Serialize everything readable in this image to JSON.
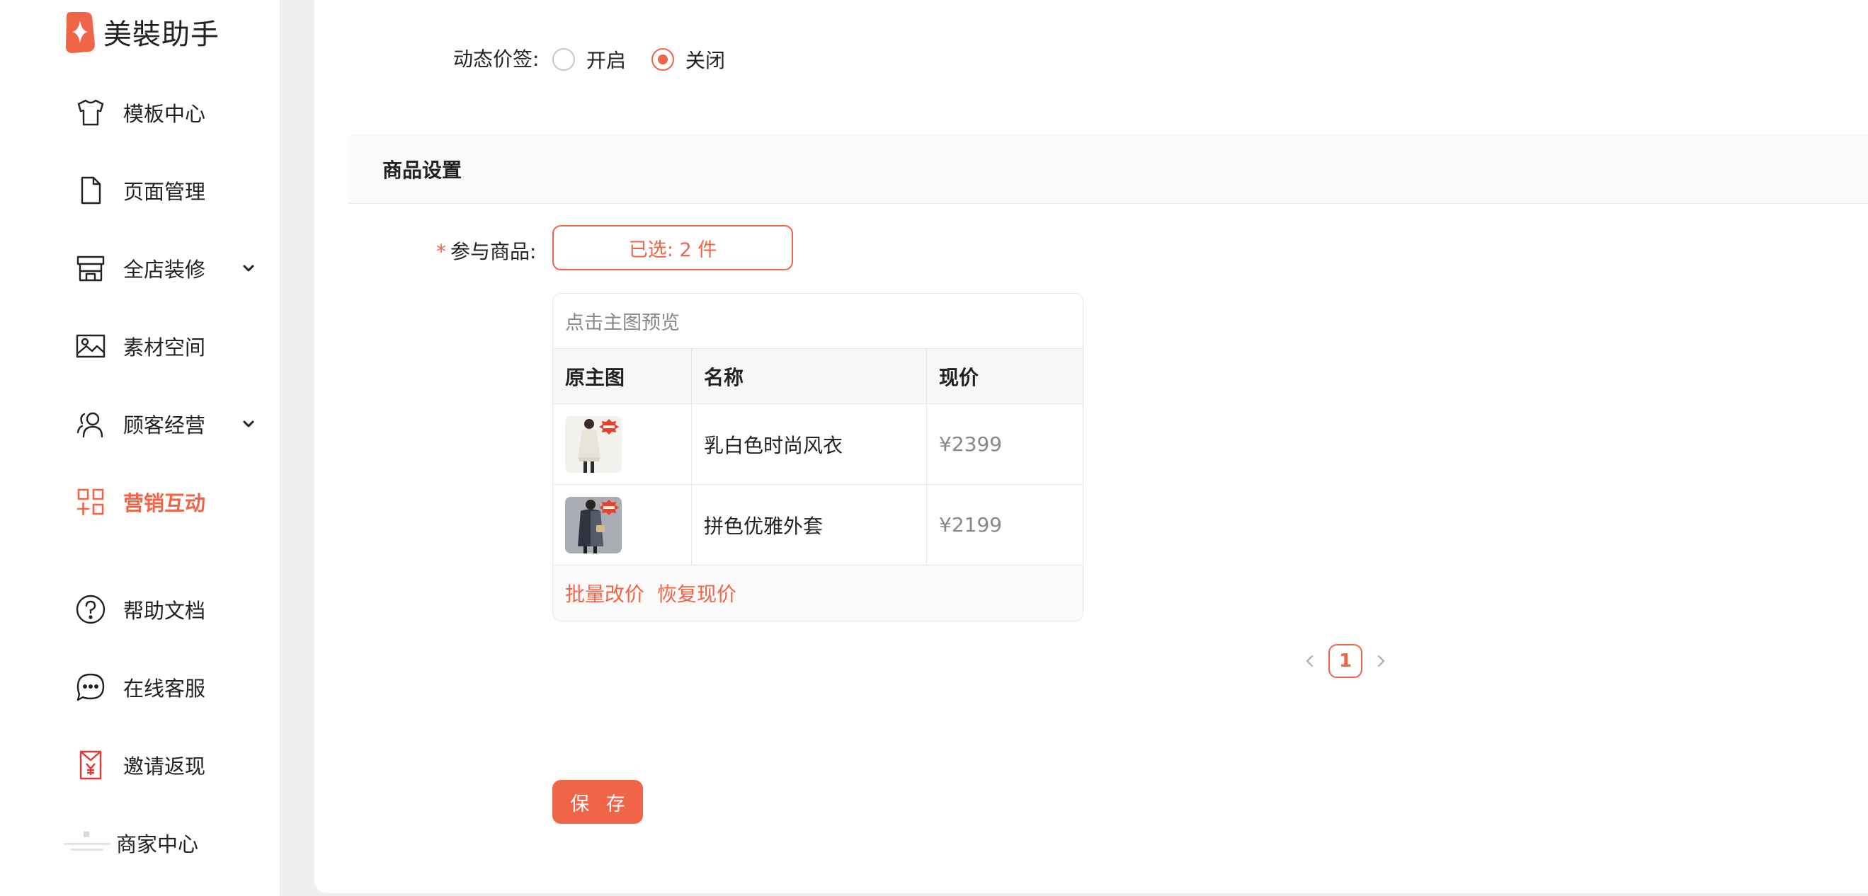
{
  "brand": {
    "name": "美裝助手",
    "accent": "#f06548"
  },
  "sidebar": {
    "items": [
      {
        "label": "模板中心",
        "icon": "tshirt-icon"
      },
      {
        "label": "页面管理",
        "icon": "document-icon"
      },
      {
        "label": "全店装修",
        "icon": "store-icon",
        "has_chevron": true
      },
      {
        "label": "素材空间",
        "icon": "image-icon"
      },
      {
        "label": "顾客经营",
        "icon": "users-icon",
        "has_chevron": true
      },
      {
        "label": "营销互动",
        "icon": "grid-plus-icon",
        "active": true
      },
      {
        "label": "帮助文档",
        "icon": "help-icon"
      },
      {
        "label": "在线客服",
        "icon": "chat-icon"
      },
      {
        "label": "邀请返现",
        "icon": "red-envelope-icon"
      },
      {
        "label": "商家中心",
        "icon": "merchant-qr-icon"
      }
    ]
  },
  "form": {
    "dynamic_price_label": "动态价签:",
    "dynamic_price_options": [
      {
        "label": "开启",
        "checked": false
      },
      {
        "label": "关闭",
        "checked": true
      }
    ],
    "section_title": "商品设置",
    "required_mark": "*",
    "goods_label": "参与商品:",
    "selected_button": "已选: 2 件"
  },
  "goods_table": {
    "hint": "点击主图预览",
    "headers": [
      "原主图",
      "名称",
      "现价"
    ],
    "rows": [
      {
        "name": "乳白色时尚风衣",
        "price": "¥2399",
        "thumb": "cream-trench-coat-image"
      },
      {
        "name": "拼色优雅外套",
        "price": "¥2199",
        "thumb": "color-block-coat-image"
      }
    ],
    "actions": [
      "批量改价",
      "恢复现价"
    ]
  },
  "pagination": {
    "current": "1"
  },
  "save_button": "保 存"
}
